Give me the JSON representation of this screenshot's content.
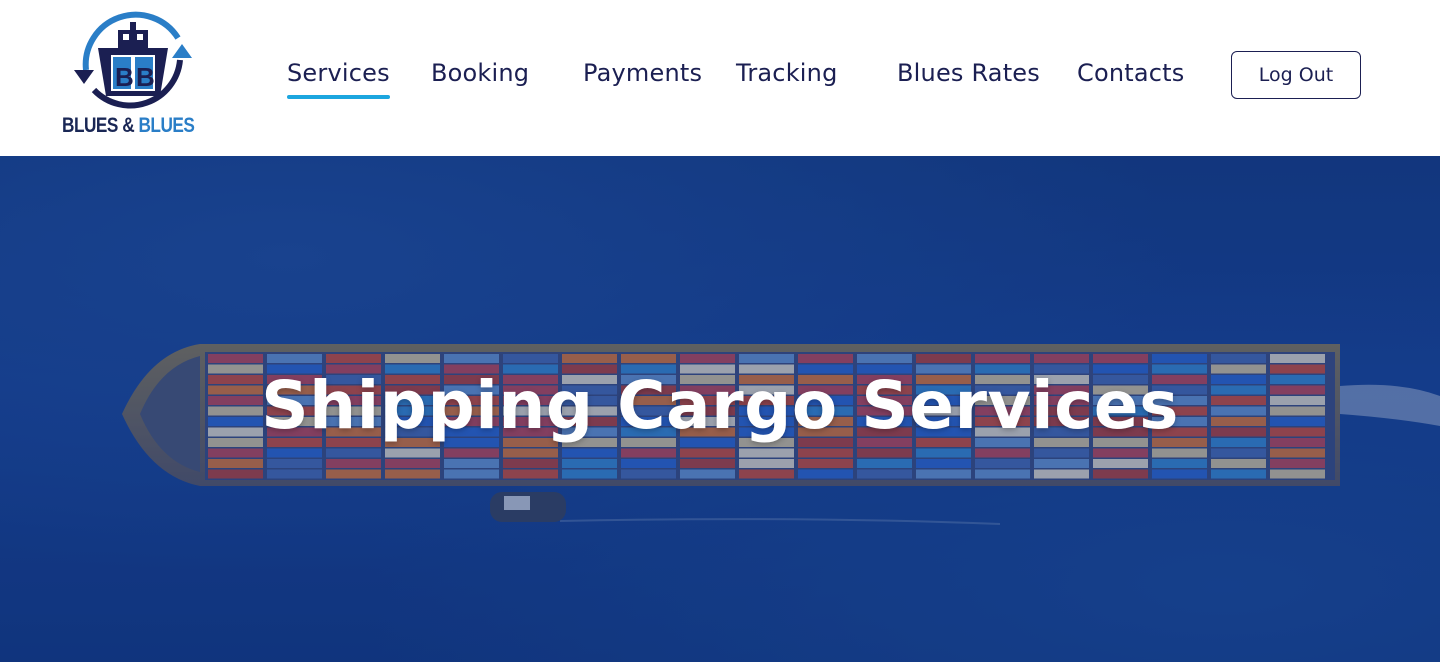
{
  "brand": {
    "name_part1": "BLUES",
    "name_amp": "&",
    "name_part2": "BLUES",
    "logo_letter": "B",
    "colors": {
      "navy": "#1b1f52",
      "blue": "#2a7ec7"
    }
  },
  "nav": {
    "items": [
      {
        "label": "Services",
        "active": true
      },
      {
        "label": "Booking",
        "active": false
      },
      {
        "label": "Payments",
        "active": false
      },
      {
        "label": "Tracking",
        "active": false
      },
      {
        "label": "Blues Rates",
        "active": false
      },
      {
        "label": "Contacts",
        "active": false
      }
    ],
    "logout_label": "Log Out",
    "active_indicator_color": "#1ca6df"
  },
  "hero": {
    "title": "Shipping Cargo Services",
    "background_image": "aerial-container-ship-on-ocean"
  }
}
